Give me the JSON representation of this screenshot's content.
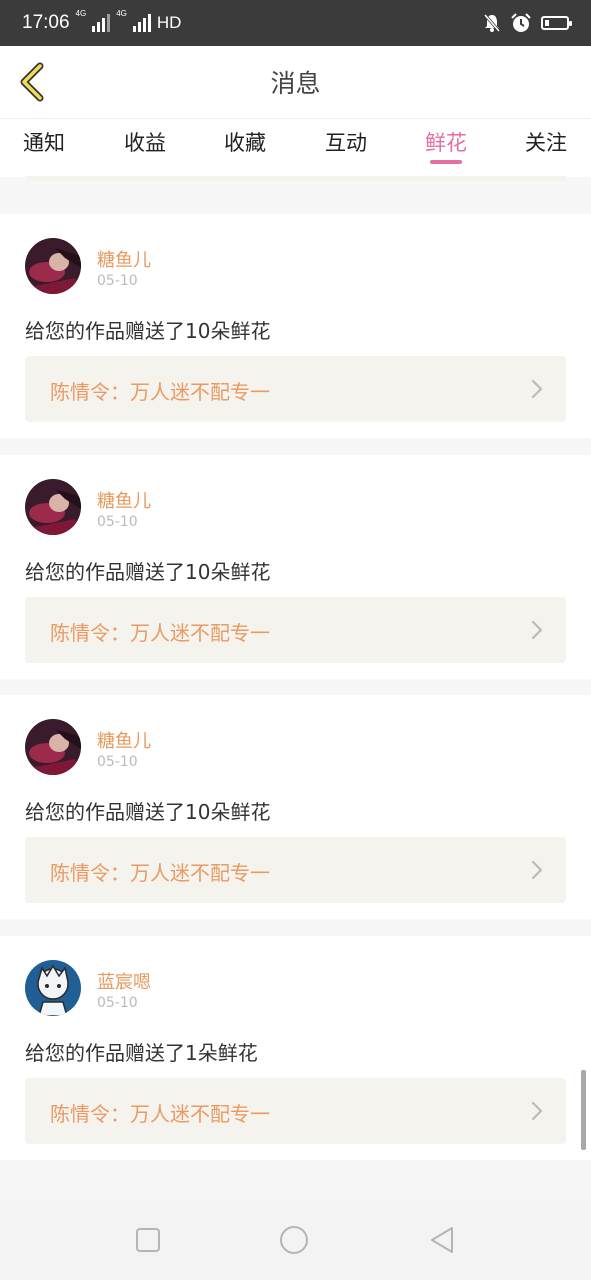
{
  "status_bar": {
    "time": "17:06",
    "net1": "4G",
    "net2": "4G",
    "hd": "HD",
    "battery_level": 0.2
  },
  "header": {
    "title": "消息"
  },
  "tabs": [
    {
      "label": "通知",
      "active": false
    },
    {
      "label": "收益",
      "active": false
    },
    {
      "label": "收藏",
      "active": false
    },
    {
      "label": "互动",
      "active": false
    },
    {
      "label": "鲜花",
      "active": true
    },
    {
      "label": "关注",
      "active": false
    }
  ],
  "messages": [
    {
      "username": "糖鱼儿",
      "date": "05-10",
      "text": "给您的作品赠送了10朵鲜花",
      "work_title": "陈情令：万人迷不配专一",
      "avatar": "dark-portrait-avatar"
    },
    {
      "username": "糖鱼儿",
      "date": "05-10",
      "text": "给您的作品赠送了10朵鲜花",
      "work_title": "陈情令：万人迷不配专一",
      "avatar": "dark-portrait-avatar"
    },
    {
      "username": "糖鱼儿",
      "date": "05-10",
      "text": "给您的作品赠送了10朵鲜花",
      "work_title": "陈情令：万人迷不配专一",
      "avatar": "dark-portrait-avatar"
    },
    {
      "username": "蓝宸嗯",
      "date": "05-10",
      "text": "给您的作品赠送了1朵鲜花",
      "work_title": "陈情令：万人迷不配专一",
      "avatar": "cartoon-boy-avatar"
    }
  ],
  "colors": {
    "accent": "#e56fa3",
    "username": "#e69a5e",
    "work_title": "#ec9a63",
    "card_bg": "#f4f3ee"
  }
}
